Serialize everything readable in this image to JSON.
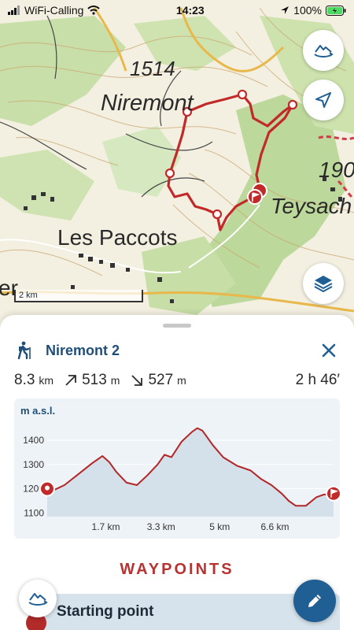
{
  "status_bar": {
    "carrier": "WiFi-Calling",
    "time": "14:23",
    "battery": "100%"
  },
  "map": {
    "labels": {
      "altitude": "1514",
      "niremont": "Niremont",
      "les_paccots": "Les Paccots",
      "teysachaux": "Teysach",
      "elevation_190": "190",
      "partial_er": "er"
    },
    "scale_label": "2 km",
    "route_color": "#c22a2a"
  },
  "route": {
    "title": "Niremont 2",
    "distance_value": "8.3",
    "distance_unit": "km",
    "ascent_value": "513",
    "ascent_unit": "m",
    "descent_value": "527",
    "descent_unit": "m",
    "duration": "2 h 46′"
  },
  "chart_data": {
    "type": "area",
    "title": "m a.s.l.",
    "xlabel": "",
    "ylabel": "m a.s.l.",
    "y_ticks": [
      "1400",
      "1300",
      "1200",
      "1100"
    ],
    "x_ticks": [
      "1.7 km",
      "3.3 km",
      "5 km",
      "6.6 km"
    ],
    "ylim": [
      1085,
      1475
    ],
    "xlim": [
      0,
      8.3
    ],
    "x": [
      0,
      0.2,
      0.5,
      0.9,
      1.3,
      1.6,
      1.8,
      2.0,
      2.3,
      2.6,
      2.9,
      3.2,
      3.4,
      3.6,
      3.9,
      4.2,
      4.35,
      4.5,
      4.8,
      5.1,
      5.5,
      5.9,
      6.2,
      6.5,
      6.8,
      7.0,
      7.2,
      7.5,
      7.8,
      8.0,
      8.3
    ],
    "y": [
      1200,
      1195,
      1215,
      1260,
      1305,
      1335,
      1310,
      1270,
      1225,
      1215,
      1255,
      1300,
      1340,
      1330,
      1395,
      1435,
      1450,
      1440,
      1380,
      1330,
      1295,
      1275,
      1240,
      1215,
      1180,
      1150,
      1130,
      1130,
      1165,
      1175,
      1180
    ],
    "fill_color": "#d5e1ea",
    "line_color": "#b32626",
    "grid": true
  },
  "waypoints": {
    "heading": "WAYPOINTS",
    "first_title": "Starting point"
  }
}
